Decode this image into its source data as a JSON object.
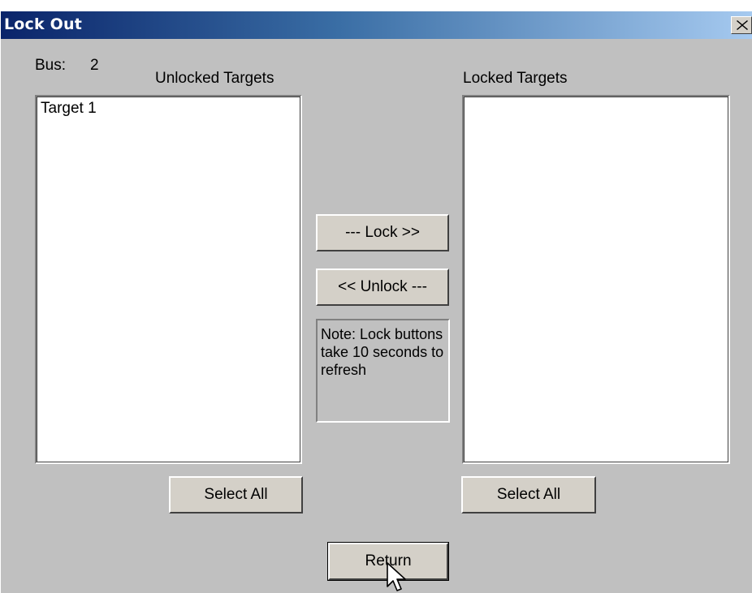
{
  "window": {
    "title": "Lock Out",
    "close_symbol": "✕"
  },
  "bus": {
    "label": "Bus:",
    "value": "2"
  },
  "unlocked": {
    "heading": "Unlocked Targets",
    "items": [
      "Target 1"
    ],
    "select_all_label": "Select All"
  },
  "locked": {
    "heading": "Locked Targets",
    "items": [],
    "select_all_label": "Select All"
  },
  "actions": {
    "lock_label": "--- Lock >>",
    "unlock_label": "<< Unlock ---",
    "note": "Note: Lock buttons take 10 seconds to refresh",
    "return_label": "Return"
  },
  "colors": {
    "title_gradient_start": "#0a246a",
    "title_gradient_end": "#a6caf0",
    "dialog_bg": "#c0c0c0",
    "button_face": "#d4d0c8"
  },
  "icons": {
    "close": "close-icon",
    "cursor": "mouse-pointer-icon"
  }
}
